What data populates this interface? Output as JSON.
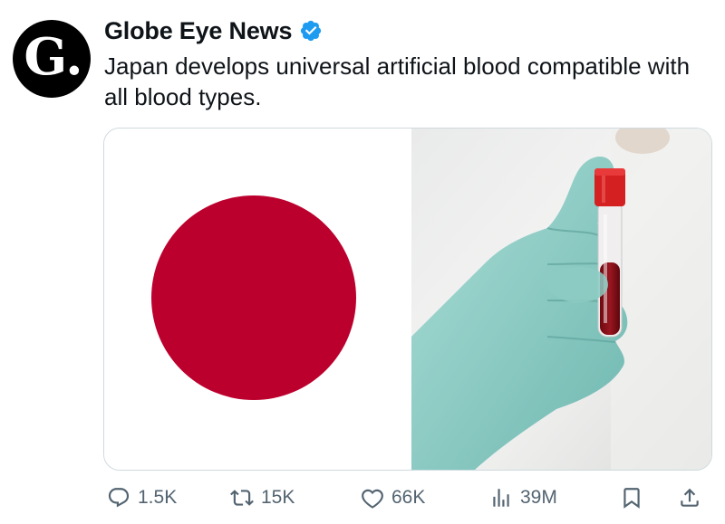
{
  "account": {
    "name": "Globe Eye News",
    "avatar_letter": "G.",
    "verified": true,
    "verified_color": "#1d9bf0"
  },
  "post": {
    "text": "Japan develops universal artificial blood compatible with all blood types."
  },
  "media": {
    "left_image": "japan-flag",
    "right_image": "gloved-hand-holding-blood-tube",
    "flag_sun_color": "#bc002d"
  },
  "actions": {
    "replies": "1.5K",
    "reposts": "15K",
    "likes": "66K",
    "views": "39M"
  },
  "colors": {
    "text_primary": "#0f1419",
    "text_secondary": "#536471",
    "border": "#cfd9de"
  }
}
